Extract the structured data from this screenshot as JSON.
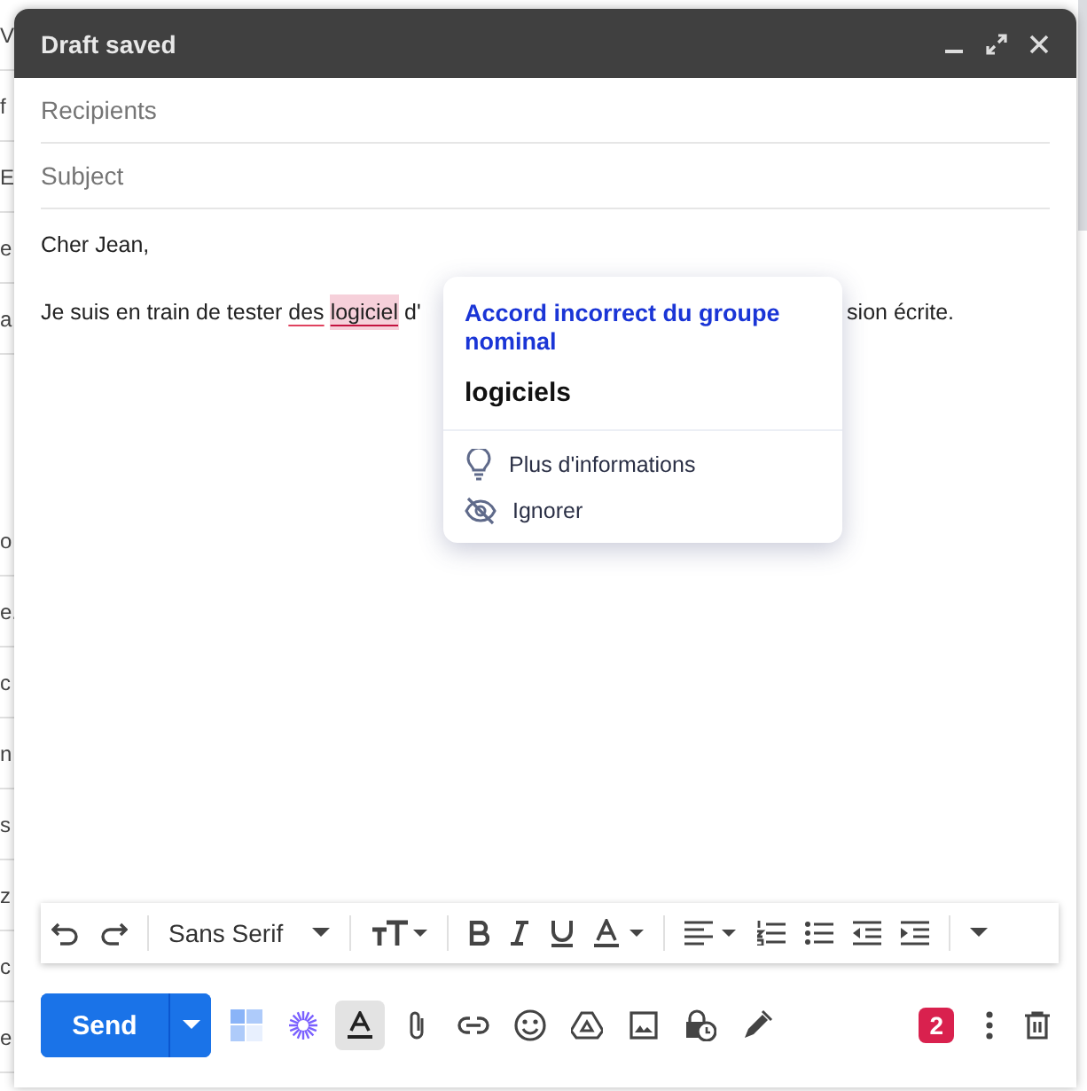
{
  "background_list": {
    "fragments": [
      "V",
      "f",
      "E",
      "e",
      "a",
      "o",
      "e.",
      "c",
      "n",
      "s",
      "z",
      "c",
      "e"
    ]
  },
  "compose": {
    "title": "Draft saved",
    "header_controls": [
      {
        "kind": "minimize"
      },
      {
        "kind": "expand"
      },
      {
        "kind": "close"
      }
    ],
    "recipients": {
      "placeholder": "Recipients"
    },
    "subject": {
      "placeholder": "Subject"
    },
    "body": {
      "greeting": "Cher Jean,",
      "line": [
        {
          "kind": "plain",
          "text": "Je suis en train de tester "
        },
        {
          "kind": "underlined",
          "text": "des"
        },
        {
          "kind": "flagged",
          "text": "logiciel"
        },
        {
          "kind": "plain",
          "text": " d'"
        }
      ],
      "line_end": "sion écrite."
    },
    "suggestion_popup": {
      "title": "Accord incorrect du groupe nominal",
      "replacement": "logiciels",
      "actions": [
        {
          "kind": "info",
          "label": "Plus d'informations"
        },
        {
          "kind": "ignore",
          "label": "Ignorer"
        }
      ]
    },
    "format_toolbar": [
      {
        "kind": "undo"
      },
      {
        "kind": "redo"
      },
      {
        "kind": "sep"
      },
      {
        "kind": "font",
        "label": "Sans Serif"
      },
      {
        "kind": "sep"
      },
      {
        "kind": "size"
      },
      {
        "kind": "sep"
      },
      {
        "kind": "bold"
      },
      {
        "kind": "italic"
      },
      {
        "kind": "underline"
      },
      {
        "kind": "color"
      },
      {
        "kind": "sep"
      },
      {
        "kind": "align"
      },
      {
        "kind": "numbered"
      },
      {
        "kind": "bulleted"
      },
      {
        "kind": "outdent"
      },
      {
        "kind": "indent"
      },
      {
        "kind": "sep"
      },
      {
        "kind": "more"
      }
    ],
    "send_label": "Send",
    "bottom_tools": [
      {
        "kind": "layouts",
        "selected": false
      },
      {
        "kind": "sparkle",
        "selected": false
      },
      {
        "kind": "formatting",
        "selected": true
      },
      {
        "kind": "attach",
        "selected": false
      },
      {
        "kind": "link",
        "selected": false
      },
      {
        "kind": "emoji",
        "selected": false
      },
      {
        "kind": "drive",
        "selected": false
      },
      {
        "kind": "photo",
        "selected": false
      },
      {
        "kind": "confidential",
        "selected": false
      },
      {
        "kind": "signature",
        "selected": false
      }
    ],
    "badge": "2"
  }
}
